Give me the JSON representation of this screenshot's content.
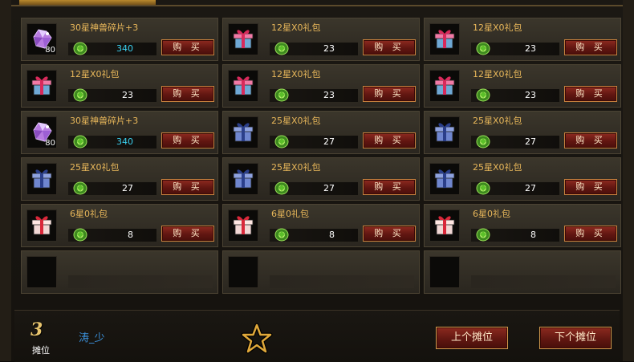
{
  "buy_label": "购 买",
  "items": [
    {
      "name": "30星神兽碎片+3",
      "icon": "purple-gem-icon",
      "qty": "80",
      "price": "340",
      "price_color": "cyan"
    },
    {
      "name": "12星X0礼包",
      "icon": "red-gift-icon",
      "qty": "",
      "price": "23",
      "price_color": "white"
    },
    {
      "name": "12星X0礼包",
      "icon": "red-gift-icon",
      "qty": "",
      "price": "23",
      "price_color": "white"
    },
    {
      "name": "12星X0礼包",
      "icon": "red-gift-icon",
      "qty": "",
      "price": "23",
      "price_color": "white"
    },
    {
      "name": "12星X0礼包",
      "icon": "red-gift-icon",
      "qty": "",
      "price": "23",
      "price_color": "white"
    },
    {
      "name": "12星X0礼包",
      "icon": "red-gift-icon",
      "qty": "",
      "price": "23",
      "price_color": "white"
    },
    {
      "name": "30星神兽碎片+3",
      "icon": "purple-gem-icon",
      "qty": "80",
      "price": "340",
      "price_color": "cyan"
    },
    {
      "name": "25星X0礼包",
      "icon": "blue-gift-icon",
      "qty": "",
      "price": "27",
      "price_color": "white"
    },
    {
      "name": "25星X0礼包",
      "icon": "blue-gift-icon",
      "qty": "",
      "price": "27",
      "price_color": "white"
    },
    {
      "name": "25星X0礼包",
      "icon": "blue-gift-icon",
      "qty": "",
      "price": "27",
      "price_color": "white"
    },
    {
      "name": "25星X0礼包",
      "icon": "blue-gift-icon",
      "qty": "",
      "price": "27",
      "price_color": "white"
    },
    {
      "name": "25星X0礼包",
      "icon": "blue-gift-icon",
      "qty": "",
      "price": "27",
      "price_color": "white"
    },
    {
      "name": "6星0礼包",
      "icon": "pink-gift-icon",
      "qty": "",
      "price": "8",
      "price_color": "white"
    },
    {
      "name": "6星0礼包",
      "icon": "pink-gift-icon",
      "qty": "",
      "price": "8",
      "price_color": "white"
    },
    {
      "name": "6星0礼包",
      "icon": "pink-gift-icon",
      "qty": "",
      "price": "8",
      "price_color": "white"
    }
  ],
  "empty_slots": 3,
  "footer": {
    "stall_number": "3",
    "stall_label": "摊位",
    "owner_name": "涛_少",
    "favorite_icon": "star-outline-icon",
    "prev_button": "上个摊位",
    "next_button": "下个摊位"
  },
  "colors": {
    "item_name": "#e8b75a",
    "price_cyan": "#3ad0ef",
    "price_white": "#ffffff",
    "owner_name": "#3b8fd8",
    "button_bg": "#611611"
  }
}
